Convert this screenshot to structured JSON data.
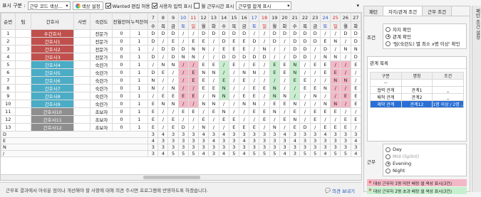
{
  "toolbar": {
    "display_label": "표시 구분 :",
    "display_select": "근무 코드 색상...",
    "color_btn": "색상 설정",
    "wanted_chk": "Wanted 편집 허용",
    "user_chk": "사용자 입력 표시",
    "hours_chk": "월 근무시간 표시",
    "sum_select": "근무별 합계 표시"
  },
  "grid": {
    "col_headers": [
      "순번",
      "팀",
      "간호사",
      "사번",
      "숙련도",
      "전월잔여",
      "누적잔여"
    ],
    "days": [
      {
        "d": "7",
        "w": "수"
      },
      {
        "d": "8",
        "w": "목"
      },
      {
        "d": "9",
        "w": "금"
      },
      {
        "d": "10",
        "w": "토"
      },
      {
        "d": "11",
        "w": "일"
      },
      {
        "d": "12",
        "w": "월"
      },
      {
        "d": "13",
        "w": "화"
      },
      {
        "d": "14",
        "w": "수"
      },
      {
        "d": "15",
        "w": "목"
      },
      {
        "d": "16",
        "w": "금"
      },
      {
        "d": "17",
        "w": "토"
      },
      {
        "d": "18",
        "w": "일"
      },
      {
        "d": "19",
        "w": "월"
      },
      {
        "d": "20",
        "w": "화"
      },
      {
        "d": "21",
        "w": "수"
      },
      {
        "d": "22",
        "w": "목"
      },
      {
        "d": "23",
        "w": "금"
      },
      {
        "d": "24",
        "w": "토"
      },
      {
        "d": "25",
        "w": "일"
      },
      {
        "d": "26",
        "w": "월"
      },
      {
        "d": "27",
        "w": "화"
      }
    ],
    "rows": [
      {
        "no": "1",
        "name": "수간호사",
        "skill": "전문가",
        "prev": "0",
        "acc": "1",
        "color": "red",
        "sched": [
          "D",
          "D",
          "D",
          "/",
          "/",
          "D",
          "D",
          "D",
          "D",
          "D",
          "/",
          "/",
          "D",
          "D",
          "D",
          "D",
          "D",
          "/",
          "/",
          "D",
          "D"
        ]
      },
      {
        "no": "2",
        "name": "간호사1",
        "skill": "전문가",
        "prev": "0",
        "acc": "1",
        "color": "red",
        "sched": [
          "D",
          "/",
          "E",
          "/",
          "E",
          "E",
          "/",
          "D",
          "E",
          "E",
          "D",
          "/",
          "D",
          "/",
          "D",
          "D",
          "D",
          "E",
          "N",
          "/",
          "D"
        ]
      },
      {
        "no": "3",
        "name": "간호사2",
        "skill": "전문가",
        "prev": "0",
        "acc": "1",
        "color": "red",
        "sched": [
          "/",
          "D",
          "D",
          "D",
          "N",
          "N",
          "/",
          "E",
          "E",
          "E",
          "/",
          "N",
          "/",
          "/",
          "D",
          "D",
          "/",
          "D",
          "/",
          "N",
          "N"
        ]
      },
      {
        "no": "4",
        "name": "간호사3",
        "skill": "전문가",
        "prev": "0",
        "acc": "1",
        "color": "red",
        "sched": [
          "D",
          "/",
          "D",
          "N",
          "N",
          "/",
          "/",
          "D",
          "D",
          "D",
          "D",
          "D",
          "/",
          "/",
          "D",
          "D",
          "/",
          "N",
          "N",
          "/",
          "D"
        ]
      },
      {
        "no": "5",
        "name": "간호사4",
        "skill": "숙련가",
        "prev": "0",
        "acc": "1",
        "color": "teal",
        "sched": [
          "/",
          "N",
          "N",
          "/",
          "/",
          "E",
          "E",
          "/",
          "E",
          "/",
          "E",
          "/",
          "E",
          "E",
          "N",
          "/",
          "E",
          "E",
          "/",
          "/",
          "E"
        ]
      },
      {
        "no": "6",
        "name": "간호사5",
        "skill": "숙련가",
        "prev": "0",
        "acc": "1",
        "color": "teal",
        "sched": [
          "D",
          "E",
          "/",
          "/",
          "E",
          "N",
          "N",
          "/",
          "/",
          "N",
          "N",
          "/",
          "E",
          "E",
          "N",
          "/",
          "/",
          "E",
          "E",
          "/",
          "/"
        ]
      },
      {
        "no": "7",
        "name": "간호사6",
        "skill": "숙련가",
        "prev": "0",
        "acc": "1",
        "color": "teal",
        "sched": [
          "N",
          "/",
          "/",
          "/",
          "E",
          "E",
          "/",
          "E",
          "/",
          "E",
          "/",
          "/",
          "/",
          "/",
          "E",
          "E",
          "/",
          "/",
          "N",
          "N",
          "/"
        ]
      },
      {
        "no": "8",
        "name": "간호사7",
        "skill": "숙련가",
        "prev": "0",
        "acc": "1",
        "color": "teal",
        "sched": [
          "N",
          "/",
          "N",
          "/",
          "/",
          "E",
          "E",
          "N",
          "/",
          "/",
          "E",
          "E",
          "N",
          "/",
          "/",
          "E",
          "E",
          "N",
          "/",
          "/",
          "E"
        ]
      },
      {
        "no": "9",
        "name": "간호사8",
        "skill": "숙련가",
        "prev": "0",
        "acc": "1",
        "color": "teal",
        "sched": [
          "/",
          "E",
          "E",
          "E",
          "E",
          "/",
          "N",
          "N",
          "/",
          "E",
          "E",
          "/",
          "N",
          "N",
          "/",
          "/",
          "N",
          "/",
          "/",
          "E",
          "E"
        ]
      },
      {
        "no": "10",
        "name": "간호사9",
        "skill": "숙련가",
        "prev": "0",
        "acc": "1",
        "color": "teal",
        "sched": [
          "E",
          "N",
          "N",
          "/",
          "/",
          "N",
          "N",
          "/",
          "/",
          "N",
          "N",
          "/",
          "E",
          "E",
          "N",
          "/",
          "/",
          "N",
          "N",
          "/",
          "E"
        ]
      },
      {
        "no": "11",
        "name": "간호사10",
        "skill": "초보자",
        "prev": "0",
        "acc": "1",
        "color": "gray",
        "sched": [
          "E",
          "/",
          "/",
          "E",
          "E",
          "/",
          "E",
          "N",
          "/",
          "/",
          "E",
          "E",
          "N",
          "/",
          "E",
          "/",
          "E",
          "E",
          "E",
          "/",
          "/"
        ]
      },
      {
        "no": "12",
        "name": "간호사11",
        "skill": "초보자",
        "prev": "0",
        "acc": "1",
        "color": "gray",
        "sched": [
          "E",
          "/",
          "E",
          "/",
          "/",
          "E",
          "/",
          "E",
          "E",
          "/",
          "/",
          "E",
          "/",
          "E",
          "N",
          "/",
          "E",
          "/",
          "/",
          "E",
          "E"
        ]
      },
      {
        "no": "13",
        "name": "간호사12",
        "skill": "초보자",
        "prev": "0",
        "acc": "1",
        "color": "gray",
        "sched": [
          "E",
          "/",
          "E",
          "D",
          "/",
          "N",
          "/",
          "/",
          "E",
          "E",
          "E",
          "/",
          "N",
          "/",
          "E",
          "D",
          "/",
          "E",
          "E",
          "E",
          "/"
        ]
      }
    ],
    "summary": [
      {
        "label": "D",
        "vals": [
          "3",
          "4",
          "3",
          "3",
          "3",
          "4",
          "3",
          "4",
          "3",
          "3",
          "3",
          "3",
          "3",
          "4",
          "3",
          "3",
          "3",
          "4",
          "3",
          "3",
          "3"
        ]
      },
      {
        "label": "E",
        "vals": [
          "4",
          "3",
          "3",
          "3",
          "3",
          "3",
          "4",
          "3",
          "3",
          "4",
          "3",
          "3",
          "3",
          "3",
          "4",
          "3",
          "3",
          "3",
          "3",
          "3",
          "4"
        ]
      },
      {
        "label": "N",
        "vals": [
          "3",
          "3",
          "3",
          "3",
          "3",
          "3",
          "3",
          "3",
          "3",
          "3",
          "3",
          "3",
          "3",
          "3",
          "3",
          "3",
          "3",
          "3",
          "3",
          "3",
          "3"
        ]
      },
      {
        "label": "/",
        "vals": [
          "3",
          "4",
          "5",
          "5",
          "5",
          "4",
          "3",
          "4",
          "5",
          "4",
          "5",
          "5",
          "5",
          "4",
          "3",
          "5",
          "5",
          "4",
          "5",
          "5",
          "4"
        ]
      }
    ]
  },
  "status": {
    "text": "근무표 결과에서 아쉬운 점이나 개선해야 할 사항에 대해 의견 주시면 프로그램에 반영하도록 하겠습니다.",
    "link": "의견 보내기"
  },
  "panel": {
    "tabs": [
      "패턴",
      "차지/관계 조건",
      "근무 조건"
    ],
    "active_tab": 1,
    "cond_label": "조건",
    "cond_options": [
      "차지 확인",
      "관계 확인",
      "'팀(숙련도) 별 최소 x명 이상' 확인"
    ],
    "cond_selected": 1,
    "rel_title": "관계 목록",
    "rel_headers": [
      "구분",
      "명칭",
      "조건"
    ],
    "rel_rows": [
      {
        "kind": "--",
        "name": "",
        "cond": ""
      },
      {
        "kind": "협력 관계",
        "name": "관계1",
        "cond": "_"
      },
      {
        "kind": "배척 관계",
        "name": "관계2",
        "cond": "_"
      },
      {
        "kind": "제약 관계",
        "name": "관계12",
        "cond": "1명 이상 / 2명 ..."
      }
    ],
    "rel_selected": 3,
    "shift_label": "근무",
    "shifts": [
      "Day",
      "Mid (Splint)",
      "Evening",
      "Night"
    ],
    "shift_disabled": [
      false,
      true,
      false,
      false
    ],
    "shift_selected": 2,
    "hint1": "대상 근무자 1명 미만 배정 셀 색상 표시(3건)",
    "hint2": "대상 근무자 2명 초과 배정 셀 색상 표시(3건)",
    "side_label": "패턴 조건 설정"
  },
  "colors": {
    "red_team": "#c0504d",
    "teal_team": "#4bacc6",
    "gray_team": "#8e8e8e",
    "highlight_pink": "#f2b8c6",
    "highlight_green": "#c6efce",
    "selection": "#2a6fd6"
  }
}
